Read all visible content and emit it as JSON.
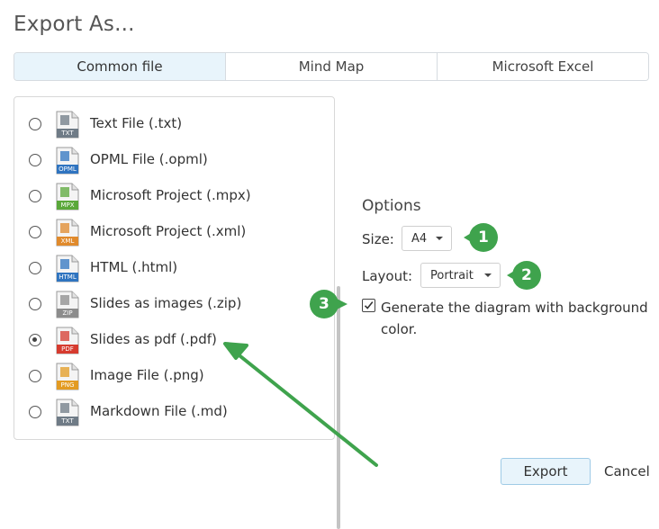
{
  "dialog": {
    "title": "Export As..."
  },
  "tabs": [
    {
      "label": "Common file",
      "active": true
    },
    {
      "label": "Mind Map",
      "active": false
    },
    {
      "label": "Microsoft Excel",
      "active": false
    }
  ],
  "files": [
    {
      "label": "Text File (.txt)",
      "icon_text": "TXT",
      "icon": "text-file-icon",
      "color": "#6f7b86",
      "selected": false
    },
    {
      "label": "OPML File (.opml)",
      "icon_text": "OPML",
      "icon": "opml-file-icon",
      "color": "#2f74c0",
      "selected": false
    },
    {
      "label": "Microsoft Project (.mpx)",
      "icon_text": "MPX",
      "icon": "project-mpx-icon",
      "color": "#5aa83a",
      "selected": false
    },
    {
      "label": "Microsoft Project (.xml)",
      "icon_text": "XML",
      "icon": "xml-file-icon",
      "color": "#e08a2c",
      "selected": false
    },
    {
      "label": "HTML (.html)",
      "icon_text": "HTML",
      "icon": "html-file-icon",
      "color": "#2f74c0",
      "selected": false
    },
    {
      "label": "Slides as images (.zip)",
      "icon_text": "ZIP",
      "icon": "zip-file-icon",
      "color": "#8c8c8c",
      "selected": false
    },
    {
      "label": "Slides as pdf (.pdf)",
      "icon_text": "PDF",
      "icon": "pdf-file-icon",
      "color": "#d63b2f",
      "selected": true
    },
    {
      "label": "Image File (.png)",
      "icon_text": "PNG",
      "icon": "png-file-icon",
      "color": "#e39b22",
      "selected": false
    },
    {
      "label": "Markdown File (.md)",
      "icon_text": "TXT",
      "icon": "markdown-file-icon",
      "color": "#6f7b86",
      "selected": false
    }
  ],
  "options": {
    "title": "Options",
    "size_label": "Size:",
    "size_value": "A4",
    "layout_label": "Layout:",
    "layout_value": "Portrait",
    "background_checkbox_label": "Generate the diagram with background color.",
    "background_checked": true
  },
  "annotations": {
    "badges": [
      "1",
      "2",
      "3"
    ],
    "color": "#3fa34d"
  },
  "buttons": {
    "export": "Export",
    "cancel": "Cancel"
  }
}
